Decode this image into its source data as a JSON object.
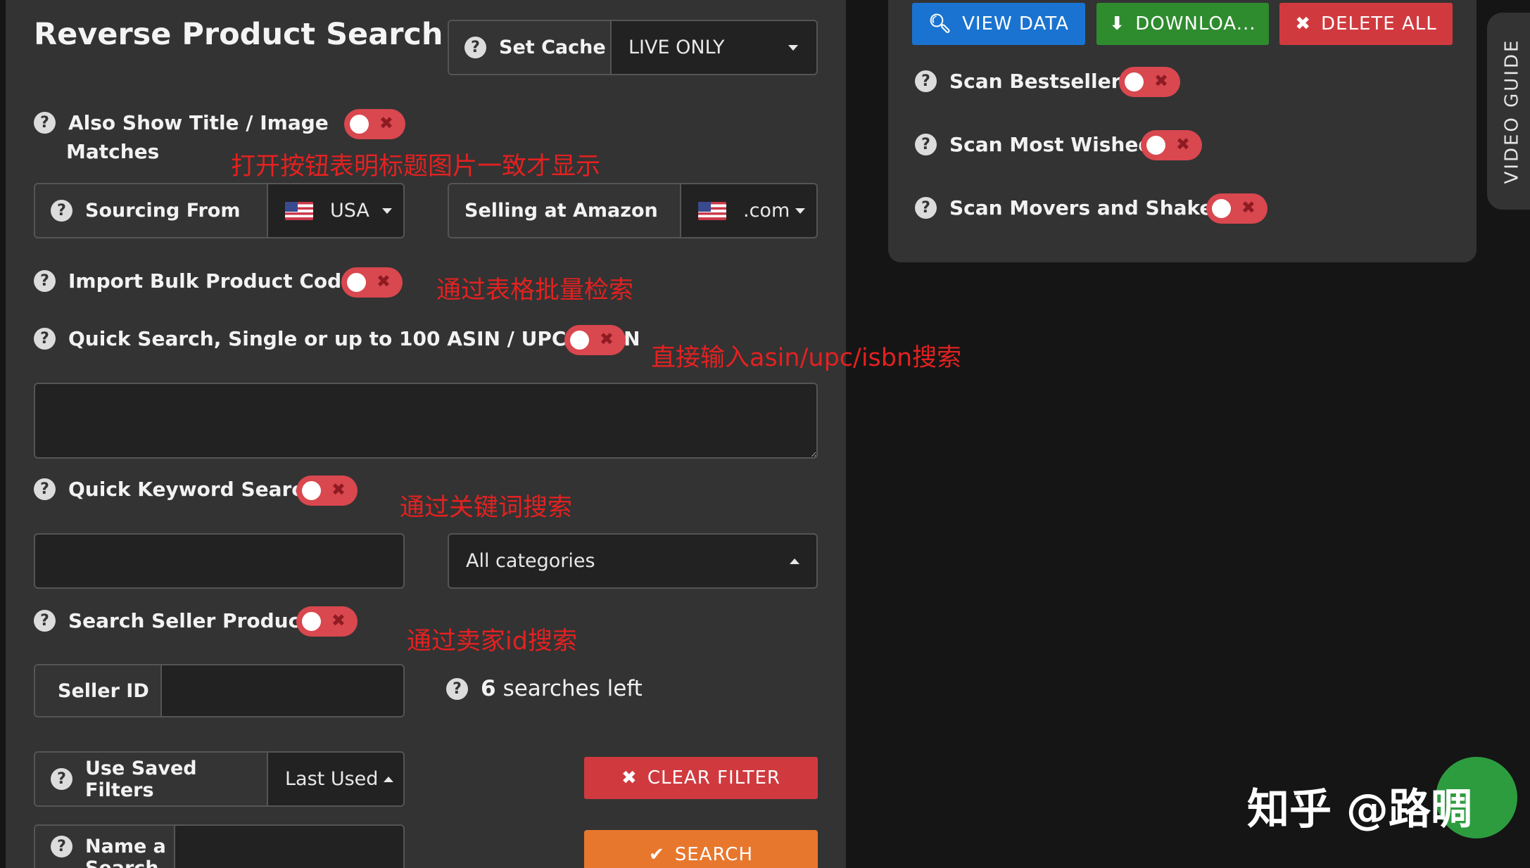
{
  "header": {
    "title": "Reverse Product Search",
    "set_cache_label": "Set Cache",
    "cache_value": "LIVE ONLY"
  },
  "options": {
    "also_show_title_line1": "Also Show Title / Image",
    "also_show_title_line2": "Matches",
    "sourcing_from_label": "Sourcing From",
    "sourcing_from_value": "USA",
    "selling_at_label": "Selling at Amazon",
    "selling_at_value": ".com",
    "import_bulk_label": "Import Bulk Product Codes",
    "quick_search_label": "Quick Search, Single or up to 100 ASIN / UPC / ISBN",
    "quick_keyword_label": "Quick Keyword Search",
    "category_value": "All categories",
    "search_seller_label": "Search Seller Products",
    "seller_id_label": "Seller ID",
    "searches_left_count": "6",
    "searches_left_text": "searches left",
    "use_saved_filters_label": "Use Saved Filters",
    "saved_filter_value": "Last Used",
    "clear_filter_label": "CLEAR FILTER",
    "name_search_label": "Name a Search",
    "search_button_label": "SEARCH"
  },
  "right": {
    "view_data_label": "VIEW DATA",
    "download_label": "DOWNLOA...",
    "delete_all_label": "DELETE ALL",
    "scan_bestsellers_label": "Scan Bestsellers",
    "scan_most_wished_label": "Scan Most Wished",
    "scan_movers_label": "Scan Movers and Shakers",
    "video_guide_label": "VIDEO GUIDE"
  },
  "annotations": {
    "title_image": "打开按钮表明标题图片一致才显示",
    "bulk": "通过表格批量检索",
    "quick_search": "直接输入asin/upc/isbn搜索",
    "keyword": "通过关键词搜索",
    "seller": "通过卖家id搜索"
  },
  "watermark": {
    "text": "知乎 @路晭"
  },
  "colors": {
    "toggle_off": "#d9474f",
    "view_data": "#1a73d0",
    "download": "#2e8b2e",
    "delete_all": "#d03a3f",
    "clear_filter": "#d03a3f",
    "search": "#e8772e",
    "annotation": "#e32121",
    "panel": "#333333"
  },
  "icons": {
    "help": "question-circle-icon",
    "search": "search-icon",
    "download": "arrow-down-icon",
    "close": "x-icon",
    "check": "check-icon",
    "flag": "us-flag-icon"
  }
}
